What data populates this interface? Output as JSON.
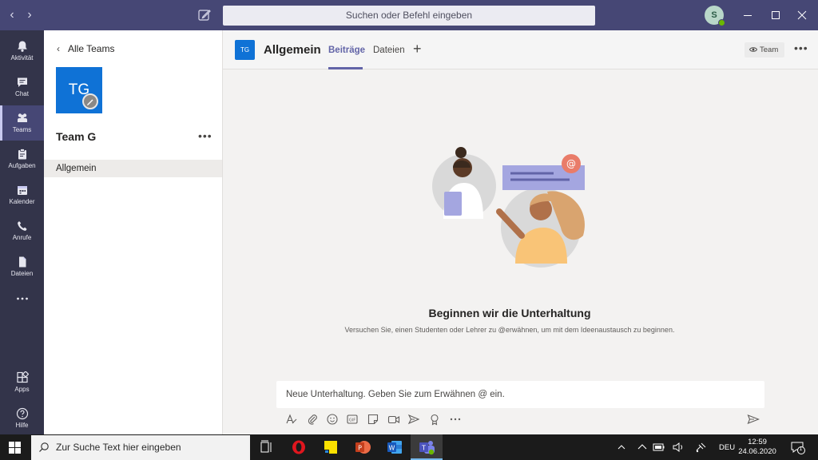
{
  "titlebar": {
    "search_placeholder": "Suchen oder Befehl eingeben",
    "avatar_initial": "S"
  },
  "rail": {
    "items": [
      {
        "label": "Aktivität"
      },
      {
        "label": "Chat"
      },
      {
        "label": "Teams"
      },
      {
        "label": "Aufgaben"
      },
      {
        "label": "Kalender"
      },
      {
        "label": "Anrufe"
      },
      {
        "label": "Dateien"
      },
      {
        "label": "Apps"
      },
      {
        "label": "Hilfe"
      }
    ]
  },
  "panel": {
    "back_label": "Alle Teams",
    "team_initials": "TG",
    "team_name": "Team G",
    "channels": [
      "Allgemein"
    ]
  },
  "channel": {
    "badge": "TG",
    "title": "Allgemein",
    "tabs": [
      "Beiträge",
      "Dateien"
    ],
    "team_button": "Team"
  },
  "empty_state": {
    "title": "Beginnen wir die Unterhaltung",
    "subtitle": "Versuchen Sie, einen Studenten oder Lehrer zu @erwähnen, um mit dem Ideenaustausch zu beginnen."
  },
  "compose": {
    "placeholder": "Neue Unterhaltung. Geben Sie zum Erwähnen @ ein."
  },
  "taskbar": {
    "search_placeholder": "Zur Suche Text hier eingeben",
    "language": "DEU",
    "time": "12:59",
    "date": "24.06.2020",
    "notification_count": "1"
  },
  "colors": {
    "titlebar": "#464775",
    "rail": "#33344a",
    "accent": "#6264a7",
    "team_tile": "#0f72d6"
  }
}
